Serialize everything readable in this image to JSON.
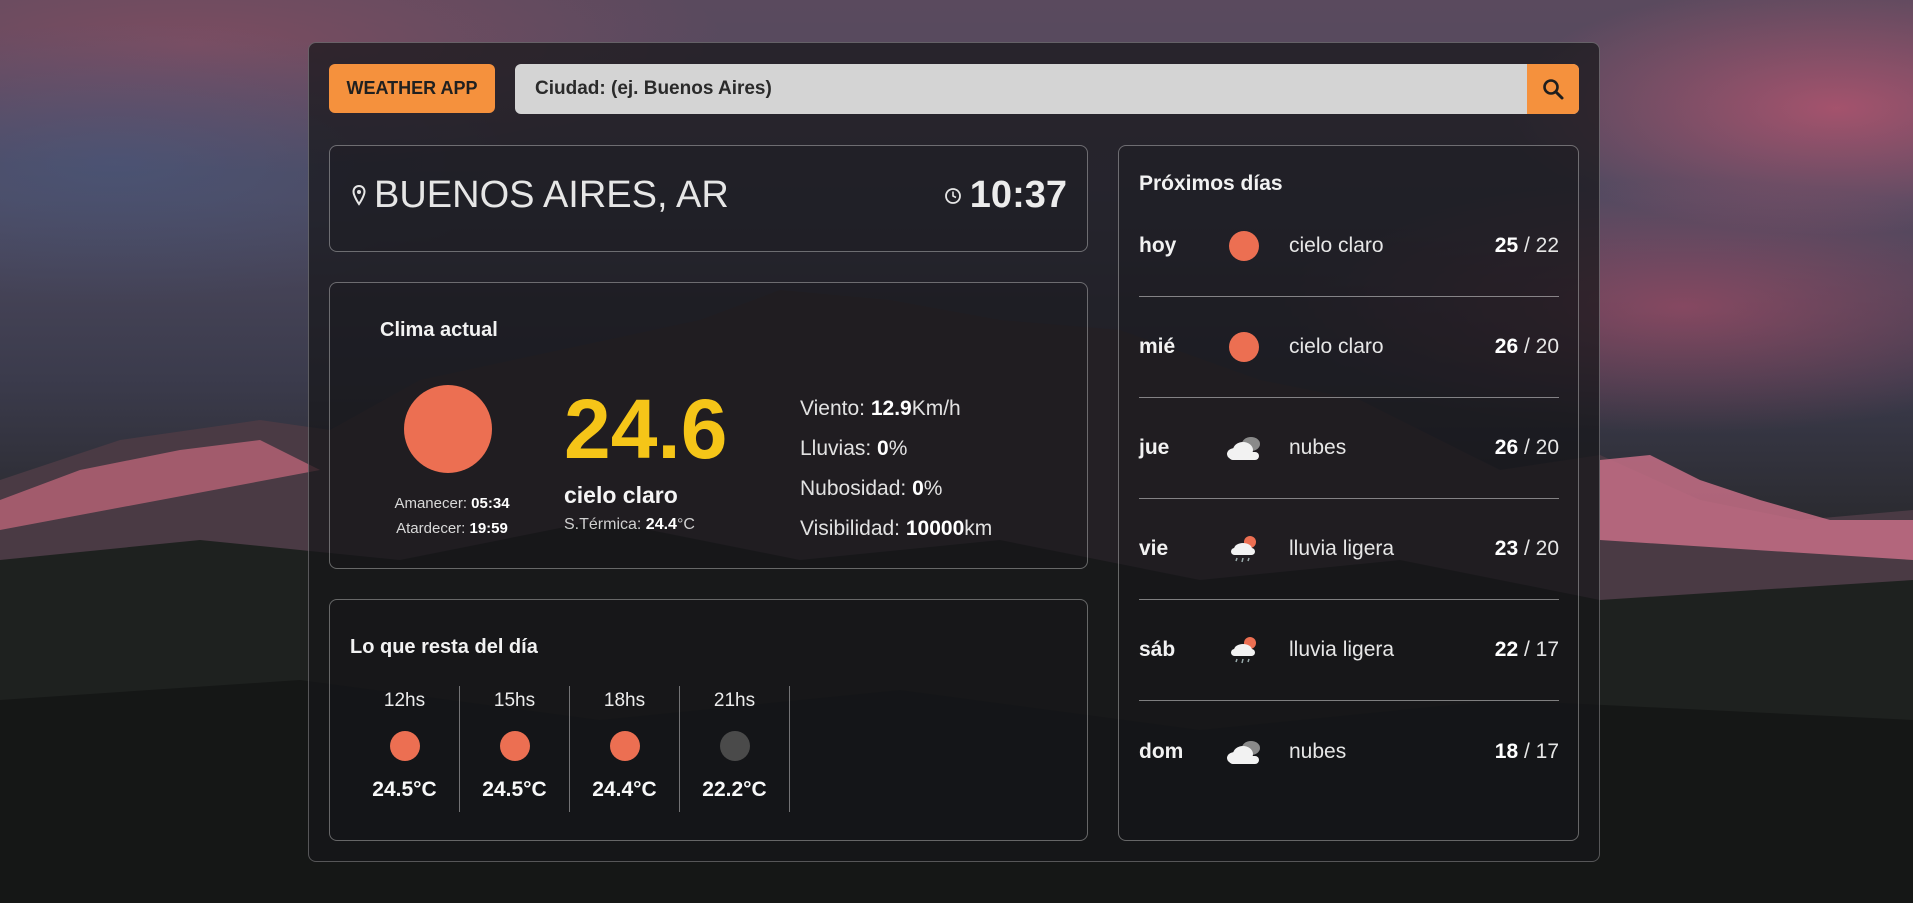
{
  "app": {
    "brand": "WEATHER APP",
    "search": {
      "placeholder": "Ciudad: (ej. Buenos Aires)",
      "value": ""
    }
  },
  "location": {
    "city": "BUENOS AIRES, AR",
    "time": "10:37"
  },
  "current": {
    "title": "Clima actual",
    "temp": "24.6",
    "description": "cielo claro",
    "feels_label": "S.Térmica:",
    "feels_value": "24.4",
    "feels_unit": "°C",
    "sunrise_label": "Amanecer:",
    "sunrise": "05:34",
    "sunset_label": "Atardecer:",
    "sunset": "19:59",
    "wind_label": "Viento:",
    "wind": "12.9",
    "wind_unit": "Km/h",
    "rain_label": "Lluvias:",
    "rain": "0",
    "rain_unit": "%",
    "clouds_label": "Nubosidad:",
    "clouds": "0",
    "clouds_unit": "%",
    "visibility_label": "Visibilidad:",
    "visibility": "10000",
    "visibility_unit": "km"
  },
  "rest_of_day": {
    "title": "Lo que resta del día",
    "hours": [
      {
        "hour": "12hs",
        "temp": "24.5°C",
        "icon": "sun-icon",
        "color": "#ec6f52"
      },
      {
        "hour": "15hs",
        "temp": "24.5°C",
        "icon": "sun-icon",
        "color": "#ec6f52"
      },
      {
        "hour": "18hs",
        "temp": "24.4°C",
        "icon": "sun-icon",
        "color": "#ec6f52"
      },
      {
        "hour": "21hs",
        "temp": "22.2°C",
        "icon": "moon-icon",
        "color": "#4a4a4a"
      }
    ]
  },
  "forecast": {
    "title": "Próximos días",
    "days": [
      {
        "day": "hoy",
        "icon": "sun-icon",
        "desc": "cielo claro",
        "max": "25",
        "min": "22"
      },
      {
        "day": "mié",
        "icon": "sun-icon",
        "desc": "cielo claro",
        "max": "26",
        "min": "20"
      },
      {
        "day": "jue",
        "icon": "clouds-icon",
        "desc": "nubes",
        "max": "26",
        "min": "20"
      },
      {
        "day": "vie",
        "icon": "light-rain-icon",
        "desc": "lluvia ligera",
        "max": "23",
        "min": "20"
      },
      {
        "day": "sáb",
        "icon": "light-rain-icon",
        "desc": "lluvia ligera",
        "max": "22",
        "min": "17"
      },
      {
        "day": "dom",
        "icon": "clouds-icon",
        "desc": "nubes",
        "max": "18",
        "min": "17"
      }
    ]
  },
  "colors": {
    "accent": "#f5913d",
    "temp": "#f5c518",
    "sun": "#ec6f52"
  }
}
